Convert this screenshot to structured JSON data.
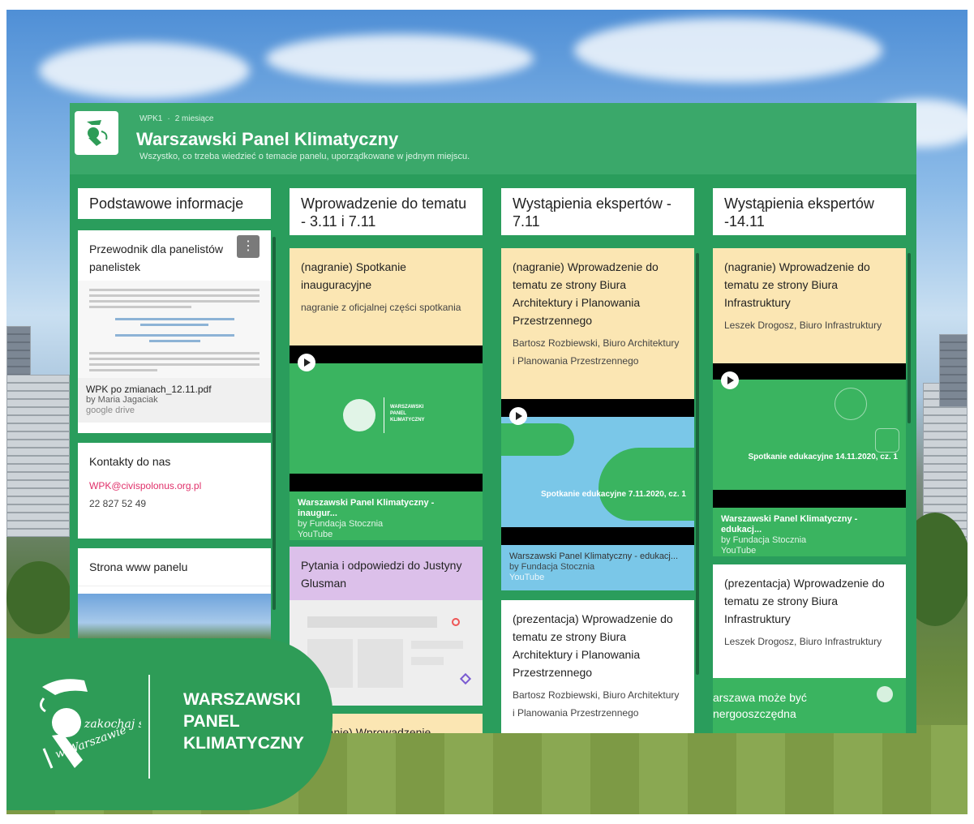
{
  "board": {
    "meta_author": "WPK1",
    "meta_age": "2 miesiące",
    "title": "Warszawski Panel Klimatyczny",
    "subtitle": "Wszystko, co trzeba wiedzieć o temacie panelu, uporządkowane w jednym miejscu.",
    "accent_color": "#2a9d5c",
    "header_color": "#3aa86a"
  },
  "columns": [
    {
      "title": "Podstawowe informacje",
      "cards": [
        {
          "title": "Przewodnik dla panelistów panelistek",
          "attachment": {
            "title": "WPK po zmianach_12.11.pdf",
            "by": "by Maria Jagaciak",
            "source": "google drive"
          }
        },
        {
          "title": "Kontakty do nas",
          "email": "WPK@civispolonus.org.pl",
          "phone": "22 827 52 49"
        },
        {
          "title": "Strona www panelu"
        }
      ]
    },
    {
      "title": "Wprowadzenie do tematu - 3.11 i 7.11",
      "cards": [
        {
          "title": "(nagranie) Spotkanie inauguracyjne",
          "text": "nagranie z oficjalnej części spotkania",
          "attachment": {
            "title": "Warszawski Panel Klimatyczny - inaugur...",
            "by": "by Fundacja Stocznia",
            "source": "YouTube"
          }
        },
        {
          "title": "Pytania i odpowiedzi do Justyny Glusman"
        },
        {
          "title": "(nagranie) Wprowadzenie"
        }
      ]
    },
    {
      "title": "Wystąpienia ekspertów - 7.11",
      "cards": [
        {
          "title": "(nagranie) Wprowadzenie do tematu ze strony Biura Architektury i Planowania Przestrzennego",
          "text": "Bartosz Rozbiewski, Biuro Architektury i Planowania Przestrzennego",
          "video_caption": "Spotkanie edukacyjne 7.11.2020, cz. 1",
          "attachment": {
            "title": "Warszawski Panel Klimatyczny - edukacj...",
            "by": "by Fundacja Stocznia",
            "source": "YouTube"
          }
        },
        {
          "title": "(prezentacja) Wprowadzenie do tematu ze strony Biura Architektury i Planowania Przestrzennego",
          "text": "Bartosz Rozbiewski, Biuro Architektury i Planowania Przestrzennego"
        }
      ]
    },
    {
      "title": "Wystąpienia ekspertów -14.11",
      "cards": [
        {
          "title": "(nagranie) Wprowadzenie do tematu ze strony Biura Infrastruktury",
          "text": "Leszek Drogosz, Biuro Infrastruktury",
          "video_caption": "Spotkanie edukacyjne 14.11.2020, cz. 1",
          "attachment": {
            "title": "Warszawski Panel Klimatyczny - edukacj...",
            "by": "by Fundacja Stocznia",
            "source": "YouTube"
          }
        },
        {
          "title": "(prezentacja) Wprowadzenie do tematu ze strony Biura Infrastruktury",
          "text": "Leszek Drogosz, Biuro Infrastruktury",
          "preview_text": "arszawa może być nergooszczędna"
        }
      ]
    }
  ],
  "video_brand": {
    "line1": "WARSZAWSKI",
    "line2": "PANEL",
    "line3": "KLIMATYCZNY"
  },
  "badge": {
    "line1": "WARSZAWSKI",
    "line2": "PANEL",
    "line3": "KLIMATYCZNY",
    "script1": "zakochaj się",
    "script2": "w Warszawie"
  }
}
